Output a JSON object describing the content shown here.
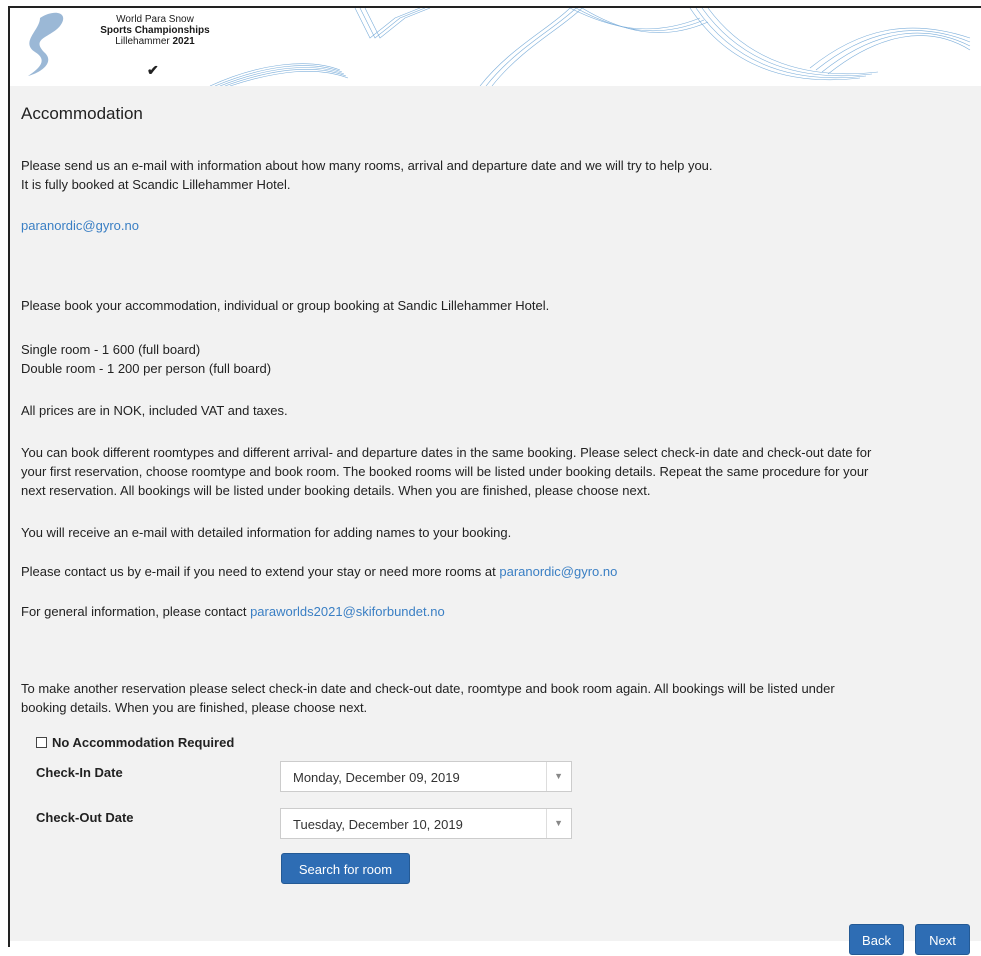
{
  "header": {
    "logo_line1": "World Para Snow",
    "logo_line2": "Sports Championships",
    "logo_line3_city": "Lillehammer",
    "logo_line3_year": "2021",
    "logo_icon": "skier-swoosh-icon",
    "check_icon": "checkmark-icon"
  },
  "page": {
    "title": "Accommodation",
    "p1_line1": "Please send us an e-mail with information about how many rooms, arrival and departure date and we will try to help you.",
    "p1_line2": "It is fully booked at Scandic Lillehammer Hotel.",
    "email_link": "paranordic@gyro.no",
    "p2": "Please book your accommodation, individual or group booking at Sandic Lillehammer Hotel.",
    "price_single": "Single room - 1 600 (full board)",
    "price_double": "Double room - 1 200 per person (full board)",
    "prices_note": "All prices are in NOK, included VAT and taxes.",
    "instructions_1": "You can book different roomtypes and different arrival- and departure dates in the same booking. Please select check-in date and check-out date for",
    "instructions_2": "your first reservation, choose roomtype and book room. The booked rooms will be listed under booking details. Repeat the same procedure for your",
    "instructions_3": "next reservation. All bookings will be listed under booking details. When you are finished, please choose next.",
    "receive_note": "You will receive an e-mail with detailed information for adding names to your booking.",
    "contact_text": "Please contact us by e-mail if you need to extend your stay or need more rooms at ",
    "contact_link": "paranordic@gyro.no",
    "general_text": "For general information, please contact ",
    "general_link": "paraworlds2021@skiforbundet.no",
    "another_1": "To make another reservation please select check-in date and check-out date, roomtype and book room again. All bookings will be listed under",
    "another_2": "booking details. When you are finished, please choose next."
  },
  "form": {
    "no_accommodation_label": "No Accommodation Required",
    "no_accommodation_checked": false,
    "checkin_label": "Check-In Date",
    "checkin_value": "Monday, December 09, 2019",
    "checkout_label": "Check-Out Date",
    "checkout_value": "Tuesday, December 10, 2019",
    "search_button": "Search for room",
    "dropdown_icon": "chevron-down-icon"
  },
  "nav": {
    "back_button": "Back",
    "next_button": "Next"
  },
  "colors": {
    "link": "#3a7fc4",
    "button": "#2e6db4",
    "content_bg": "#f2f2f2"
  }
}
